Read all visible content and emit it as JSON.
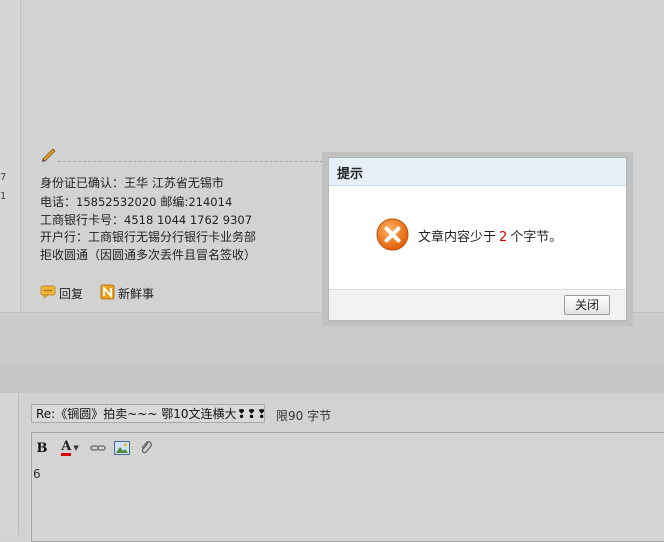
{
  "left_strip": {
    "num1": "7",
    "num2": "1"
  },
  "signature": {
    "line1": "身份证已确认：王华  江苏省无锡市",
    "line2_label": "电话：",
    "line2_phone": "15852532020",
    "line2_zip_label": " 邮编:",
    "line2_zip": "214014",
    "line3_label": "工商银行卡号：",
    "line3_card": "4518 1044 1762 9307",
    "line4": "开户行：工商银行无锡分行银行卡业务部",
    "line5": "拒收圆通（因圆通多次丢件且冒名签收）"
  },
  "actions": {
    "reply": "回复",
    "news": "新鲜事"
  },
  "reply_form": {
    "title_value": "Re:《锎圆》拍卖~~~ 鄂10文连横大❢❢❢",
    "limit_text": "限90 字节",
    "editor_content": "6"
  },
  "toolbar": {
    "bold": "B",
    "font_color": "A"
  },
  "dialog": {
    "title": "提示",
    "message_prefix": "文章内容少于",
    "message_number": "2",
    "message_suffix": "个字节。",
    "close_label": "关闭"
  },
  "colors": {
    "dialog_header": "#e6eef7",
    "error_icon": "#f07a1c",
    "highlight": "#dd0000"
  }
}
